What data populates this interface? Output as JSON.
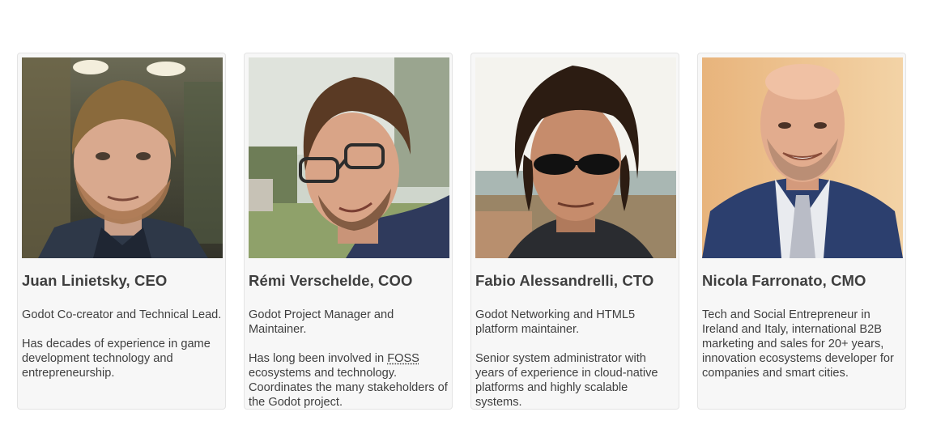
{
  "team": [
    {
      "name": "Juan Linietsky, CEO",
      "photo_alt": "Juan Linietsky",
      "paragraphs": [
        "Godot Co-creator and Technical Lead.",
        "Has decades of experience in game development technology and entrepreneurship."
      ]
    },
    {
      "name": "Rémi Verschelde, COO",
      "photo_alt": "Rémi Verschelde",
      "paragraphs": [
        "Godot Project Manager and Maintainer."
      ],
      "p2_before": "Has long been involved in ",
      "p2_abbr": "FOSS",
      "p2_after": " ecosystems and technology. Coordinates the many stakeholders of the Godot project."
    },
    {
      "name": "Fabio Alessandrelli, CTO",
      "photo_alt": "Fabio Alessandrelli",
      "paragraphs": [
        "Godot Networking and HTML5 platform maintainer.",
        "Senior system administrator with years of experience in cloud-native platforms and highly scalable systems."
      ]
    },
    {
      "name": "Nicola Farronato, CMO",
      "photo_alt": "Nicola Farronato",
      "paragraphs": [
        "Tech and Social Entrepreneur in Ireland and Italy, international B2B marketing and sales for 20+ years, innovation ecosystems developer for companies and smart cities."
      ]
    }
  ],
  "colors": {
    "card_bg": "#f7f7f7",
    "card_border": "#e4e4e4",
    "text": "#3f3f3f"
  }
}
